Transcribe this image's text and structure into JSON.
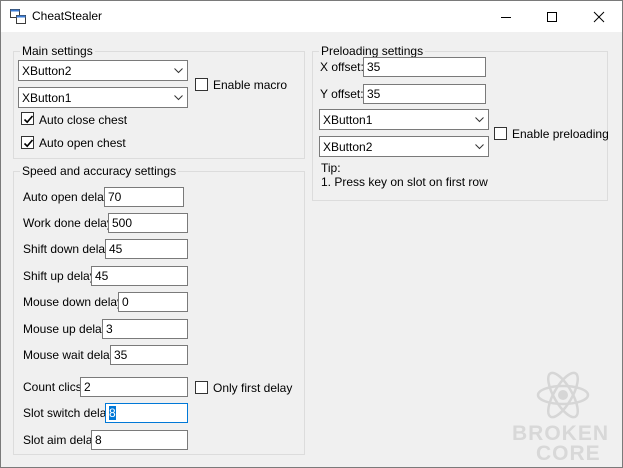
{
  "window": {
    "title": "CheatStealer",
    "app_icon": "app-window-icon",
    "controls": [
      "minimize-icon",
      "maximize-icon",
      "close-icon"
    ]
  },
  "main_settings": {
    "label": "Main settings",
    "combo1": "XButton2",
    "combo2": "XButton1",
    "enable_macro": {
      "label": "Enable macro",
      "checked": false
    },
    "auto_close_chest": {
      "label": "Auto close chest",
      "checked": true
    },
    "auto_open_chest": {
      "label": "Auto open chest",
      "checked": true
    }
  },
  "speed": {
    "label": "Speed and accuracy settings",
    "fields": [
      {
        "label": "Auto open delay:",
        "value": "70"
      },
      {
        "label": "Work done delay:",
        "value": "500"
      },
      {
        "label": "Shift down delay:",
        "value": "45"
      },
      {
        "label": "Shift up delay:",
        "value": "45"
      },
      {
        "label": "Mouse down delay:",
        "value": "0"
      },
      {
        "label": "Mouse up delay:",
        "value": "3"
      },
      {
        "label": "Mouse wait delay:",
        "value": "35"
      },
      {
        "label": "Count clics:",
        "value": "2"
      },
      {
        "label": "Slot switch delay:",
        "value": "8"
      },
      {
        "label": "Slot aim delay:",
        "value": "8"
      }
    ],
    "only_first_delay": {
      "label": "Only first delay",
      "checked": false
    }
  },
  "preloading": {
    "label": "Preloading settings",
    "x_offset_label": "X offset:",
    "x_offset": "35",
    "y_offset_label": "Y offset:",
    "y_offset": "35",
    "combo1": "XButton1",
    "combo2": "XButton2",
    "enable_preloading": {
      "label": "Enable preloading",
      "checked": false
    },
    "tip_title": "Tip:",
    "tip_text": "1. Press key on slot on first row"
  },
  "watermark": {
    "line1": "BROKEN",
    "line2": "CORE",
    "icon": "atom-icon"
  },
  "colors": {
    "selection": "#0078d7",
    "background": "#f0f0f0",
    "border": "#7a7a7a"
  }
}
